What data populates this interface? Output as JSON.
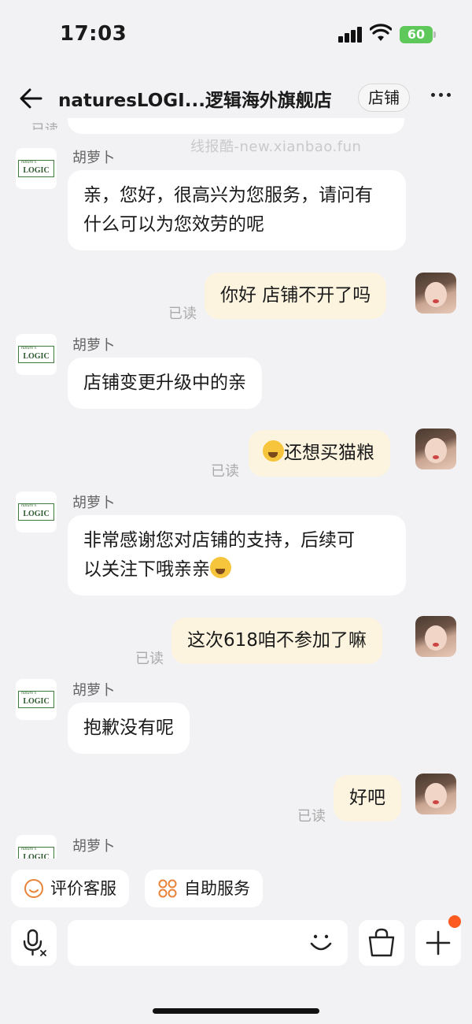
{
  "status_bar": {
    "time": "17:03",
    "battery": "60"
  },
  "header": {
    "title": "naturesLOGI...逻辑海外旗舰店",
    "shop_button": "店铺",
    "back_icon": "back-arrow-icon",
    "more_icon": "more-dots-icon"
  },
  "watermark": "线报酷-new.xianbao.fun",
  "read_label": "已读",
  "agent": {
    "name": "胡萝卜",
    "logo_text": "LOGIC",
    "logo_small": "nature's"
  },
  "messages": [
    {
      "side": "left",
      "sender": "胡萝卜",
      "text": "亲，您好，很高兴为您服务，请问有什么可以为您效劳的呢"
    },
    {
      "side": "right",
      "text": "你好 店铺不开了吗",
      "read": "已读"
    },
    {
      "side": "left",
      "sender": "胡萝卜",
      "text": "店铺变更升级中的亲"
    },
    {
      "side": "right",
      "text": "还想买猫粮",
      "emoji": "crying-face",
      "read": "已读"
    },
    {
      "side": "left",
      "sender": "胡萝卜",
      "text_line1": "非常感谢您对店铺的支持，后续可",
      "text_line2": "以关注下哦亲亲",
      "emoji": "kissing-face"
    },
    {
      "side": "right",
      "text": "这次618咱不参加了嘛",
      "read": "已读"
    },
    {
      "side": "left",
      "sender": "胡萝卜",
      "text": "抱歉没有呢"
    },
    {
      "side": "right",
      "text": "好吧",
      "read": "已读"
    },
    {
      "side": "left",
      "sender": "胡萝卜"
    }
  ],
  "quick_actions": [
    {
      "label": "评价客服",
      "icon": "smiley-rating-icon"
    },
    {
      "label": "自助服务",
      "icon": "self-service-icon"
    }
  ],
  "input_bar": {
    "voice_icon": "voice-input-icon",
    "emoji_icon": "emoji-icon",
    "bag_icon": "shopping-bag-icon",
    "plus_icon": "plus-icon",
    "placeholder": ""
  },
  "colors": {
    "background": "#f2f2f4",
    "my_bubble": "#fcf4df",
    "agent_bubble": "#ffffff",
    "badge": "#ff5a1f",
    "battery": "#5fc85a"
  }
}
